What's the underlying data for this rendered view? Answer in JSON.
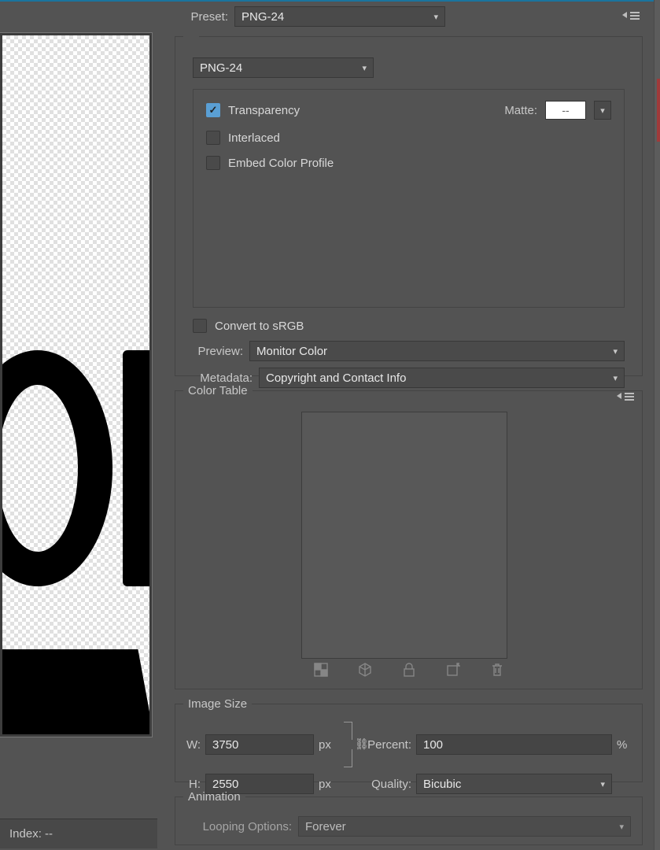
{
  "preset": {
    "label": "Preset:",
    "value": "PNG-24",
    "format_value": "PNG-24",
    "transparency_label": "Transparency",
    "transparency_checked": true,
    "interlaced_label": "Interlaced",
    "interlaced_checked": false,
    "embed_label": "Embed Color Profile",
    "embed_checked": false,
    "matte_label": "Matte:",
    "matte_value": "--",
    "convert_label": "Convert to sRGB",
    "convert_checked": false,
    "preview_label": "Preview:",
    "preview_value": "Monitor Color",
    "metadata_label": "Metadata:",
    "metadata_value": "Copyright and Contact Info"
  },
  "color_table": {
    "legend": "Color Table"
  },
  "image_size": {
    "legend": "Image Size",
    "w_label": "W:",
    "w_value": "3750",
    "h_label": "H:",
    "h_value": "2550",
    "unit": "px",
    "percent_label": "Percent:",
    "percent_value": "100",
    "percent_unit": "%",
    "quality_label": "Quality:",
    "quality_value": "Bicubic"
  },
  "animation": {
    "legend": "Animation",
    "looping_label": "Looping Options:",
    "looping_value": "Forever"
  },
  "index_bar": {
    "label": "Index: --"
  }
}
